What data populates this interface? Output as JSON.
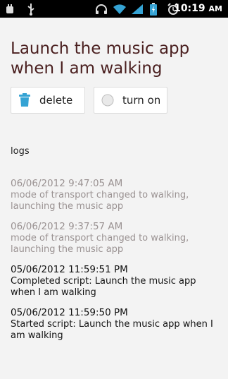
{
  "status_bar": {
    "time": "10:19",
    "ampm": "AM",
    "icons": [
      "usb-debug-icon",
      "usb-icon",
      "headphones-icon",
      "wifi-icon",
      "signal-icon",
      "battery-icon",
      "alarm-icon"
    ]
  },
  "page": {
    "title": "Launch the music app when I am walking"
  },
  "actions": {
    "delete_label": "delete",
    "turn_on_label": "turn on"
  },
  "logs": {
    "label": "logs",
    "entries": [
      {
        "timestamp": "06/06/2012 9:47:05 AM",
        "message": "mode of transport changed to walking, launching the  music app"
      },
      {
        "timestamp": "06/06/2012 9:37:57 AM",
        "message": "mode of transport changed to walking, launching the  music app"
      },
      {
        "timestamp": "05/06/2012 11:59:51 PM",
        "message": "Completed script: Launch the music app when I am walking"
      },
      {
        "timestamp": "05/06/2012 11:59:50 PM",
        "message": "Started script: Launch the music app when I am walking"
      }
    ]
  },
  "colors": {
    "title": "#4a1f1f",
    "faded_log": "#9a9292",
    "accent": "#35a3d4"
  }
}
